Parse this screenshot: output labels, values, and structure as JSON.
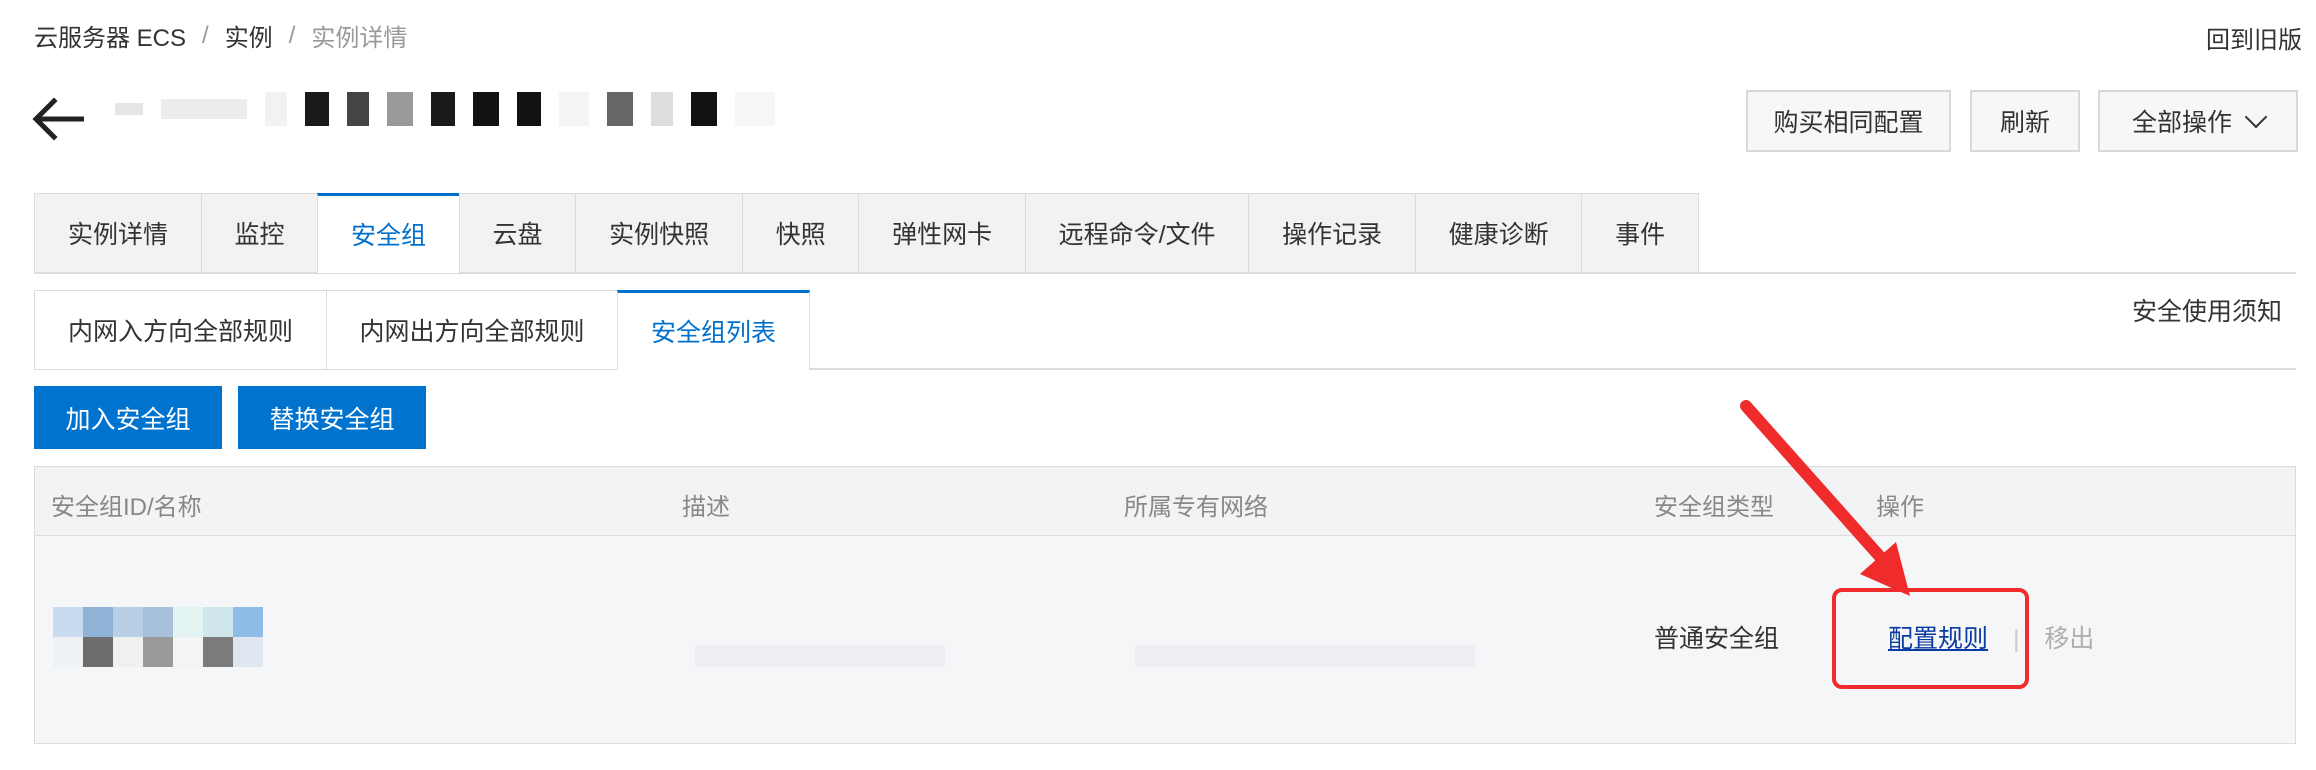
{
  "breadcrumb": {
    "items": [
      "云服务器 ECS",
      "实例",
      "实例详情"
    ],
    "separator": "/"
  },
  "header": {
    "back_to_old": "回到旧版",
    "actions": {
      "buy_same": "购买相同配置",
      "refresh": "刷新",
      "all_actions": "全部操作"
    }
  },
  "main_tabs": [
    {
      "label": "实例详情",
      "active": false
    },
    {
      "label": "监控",
      "active": false
    },
    {
      "label": "安全组",
      "active": true
    },
    {
      "label": "云盘",
      "active": false
    },
    {
      "label": "实例快照",
      "active": false
    },
    {
      "label": "快照",
      "active": false
    },
    {
      "label": "弹性网卡",
      "active": false
    },
    {
      "label": "远程命令/文件",
      "active": false
    },
    {
      "label": "操作记录",
      "active": false
    },
    {
      "label": "健康诊断",
      "active": false
    },
    {
      "label": "事件",
      "active": false
    }
  ],
  "sub_tabs": [
    {
      "label": "内网入方向全部规则",
      "active": false
    },
    {
      "label": "内网出方向全部规则",
      "active": false
    },
    {
      "label": "安全组列表",
      "active": true
    }
  ],
  "security_notice": "安全使用须知",
  "buttons": {
    "join": "加入安全组",
    "replace": "替换安全组"
  },
  "table": {
    "columns": [
      "安全组ID/名称",
      "描述",
      "所属专有网络",
      "安全组类型",
      "操作"
    ],
    "rows": [
      {
        "type": "普通安全组",
        "actions": {
          "config": "配置规则",
          "remove": "移出"
        }
      }
    ]
  },
  "colors": {
    "primary": "#0073cf",
    "active_tab": "#0070cc",
    "annotation_red": "#ef2b2b",
    "link": "#0b3b9e"
  },
  "icons": {
    "back": "arrow-left-icon",
    "dropdown": "chevron-down-icon",
    "annotation_arrow": "red-arrow-icon"
  }
}
